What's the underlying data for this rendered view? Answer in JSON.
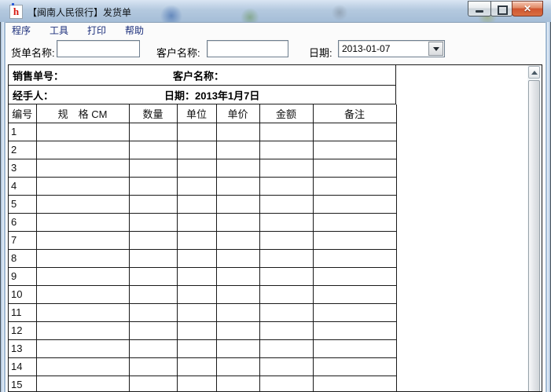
{
  "window": {
    "title": "【闽南人民很行】发货单",
    "icon_glyph": "h",
    "buttons": {
      "close_glyph": "✕"
    }
  },
  "menu": {
    "items": [
      "程序",
      "工具",
      "打印",
      "帮助"
    ]
  },
  "toolbar": {
    "fields": {
      "order": {
        "label": "货单名称:",
        "value": ""
      },
      "customer": {
        "label": "客户名称:",
        "value": ""
      },
      "date": {
        "label": "日期:",
        "value": "2013-01-07"
      }
    }
  },
  "form": {
    "sales_no_label": "销售单号：",
    "customer_name_label": "客户名称：",
    "handler_label": "经手人：",
    "date_text": "日期：2013年1月7日",
    "columns": [
      "编号",
      "规　格 CM",
      "数量",
      "单位",
      "单价",
      "金额",
      "备注"
    ],
    "row_numbers": [
      "1",
      "2",
      "3",
      "4",
      "5",
      "6",
      "7",
      "8",
      "9",
      "10",
      "11",
      "12",
      "13",
      "14",
      "15"
    ]
  },
  "icons": {
    "scroll_up": "▲",
    "combo_arrow": "▼"
  },
  "colors": {
    "close_button": "#cf5530",
    "titlebar": "#b4c9df",
    "grid_line": "#1a1a1a"
  }
}
